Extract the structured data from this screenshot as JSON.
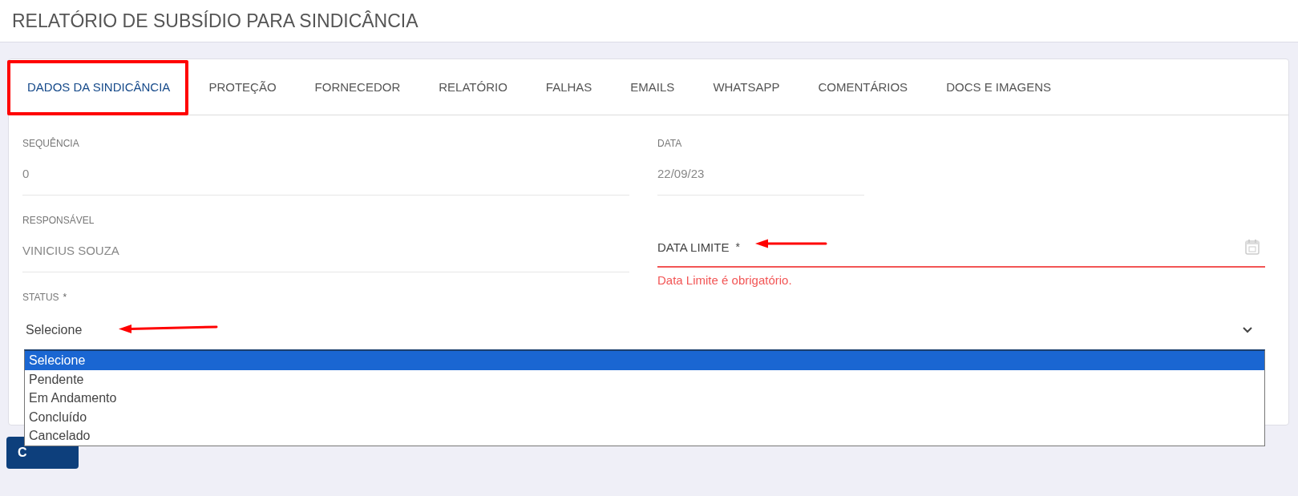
{
  "page_title": "RELATÓRIO DE SUBSÍDIO PARA SINDICÂNCIA",
  "tabs": [
    {
      "label": "DADOS DA SINDICÂNCIA",
      "selected": true
    },
    {
      "label": "PROTEÇÃO",
      "selected": false
    },
    {
      "label": "FORNECEDOR",
      "selected": false
    },
    {
      "label": "RELATÓRIO",
      "selected": false
    },
    {
      "label": "FALHAS",
      "selected": false
    },
    {
      "label": "EMAILS",
      "selected": false
    },
    {
      "label": "WHATSAPP",
      "selected": false
    },
    {
      "label": "COMENTÁRIOS",
      "selected": false
    },
    {
      "label": "DOCS E IMAGENS",
      "selected": false
    }
  ],
  "fields": [
    {
      "kind": "text",
      "label": "SEQUÊNCIA",
      "value": "0",
      "disabled": true
    },
    {
      "kind": "text",
      "label": "DATA",
      "value": "22/09/23",
      "disabled": true
    },
    {
      "kind": "text",
      "label": "RESPONSÁVEL",
      "value": "VINICIUS SOUZA",
      "disabled": true
    },
    {
      "kind": "date",
      "label": "DATA LIMITE",
      "required_mark": "*",
      "error": "Data Limite é obrigatório."
    }
  ],
  "status": {
    "label": "STATUS",
    "required_mark": "*",
    "value": "Selecione",
    "options": [
      {
        "label": "Selecione",
        "selected": true
      },
      {
        "label": "Pendente",
        "selected": false
      },
      {
        "label": "Em Andamento",
        "selected": false
      },
      {
        "label": "Concluído",
        "selected": false
      },
      {
        "label": "Cancelado",
        "selected": false
      }
    ]
  },
  "button": {
    "label": "C"
  }
}
